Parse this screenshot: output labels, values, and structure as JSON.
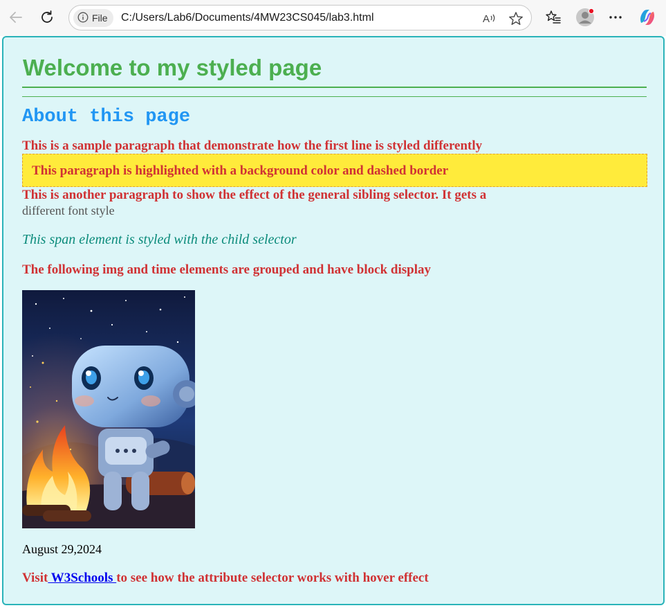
{
  "browser": {
    "file_label": "File",
    "url": "C:/Users/Lab6/Documents/4MW23CS045/lab3.html"
  },
  "page": {
    "heading": "Welcome to my styled page",
    "subheading": "About this page",
    "p_first_line": "This is a sample paragraph that demonstrate how the first line is styled differently",
    "p_highlighted": "This paragraph is highlighted with a background color and dashed border",
    "p_sibling_line1": "This is another paragraph to show the effect of the general sibling selector. It gets a",
    "p_sibling_line2": "different font style",
    "span_child": "This span element is styled with the child selector",
    "p_grouped": "The following img and time elements are grouped and have block display",
    "time": "August 29,2024",
    "p_visit_before": "Visit",
    "link_text": " W3Schools ",
    "p_visit_after": "to see how the attribute selector works with hover effect"
  },
  "colors": {
    "heading": "#4caf50",
    "subheading": "#2196f3",
    "red_text": "#d03234",
    "highlight_bg": "#ffeb3b",
    "page_bg": "#ddf6f8",
    "frame_border": "#2ab3b9",
    "italic_text": "#0b8b7b",
    "link": "#0000ee"
  },
  "icons": {
    "back": "back-arrow-icon",
    "refresh": "refresh-icon",
    "info": "info-icon",
    "read_aloud": "read-aloud-icon",
    "favorite": "star-icon",
    "favorites": "favorites-list-icon",
    "profile": "profile-avatar-icon",
    "more": "more-icon",
    "copilot": "copilot-icon"
  }
}
